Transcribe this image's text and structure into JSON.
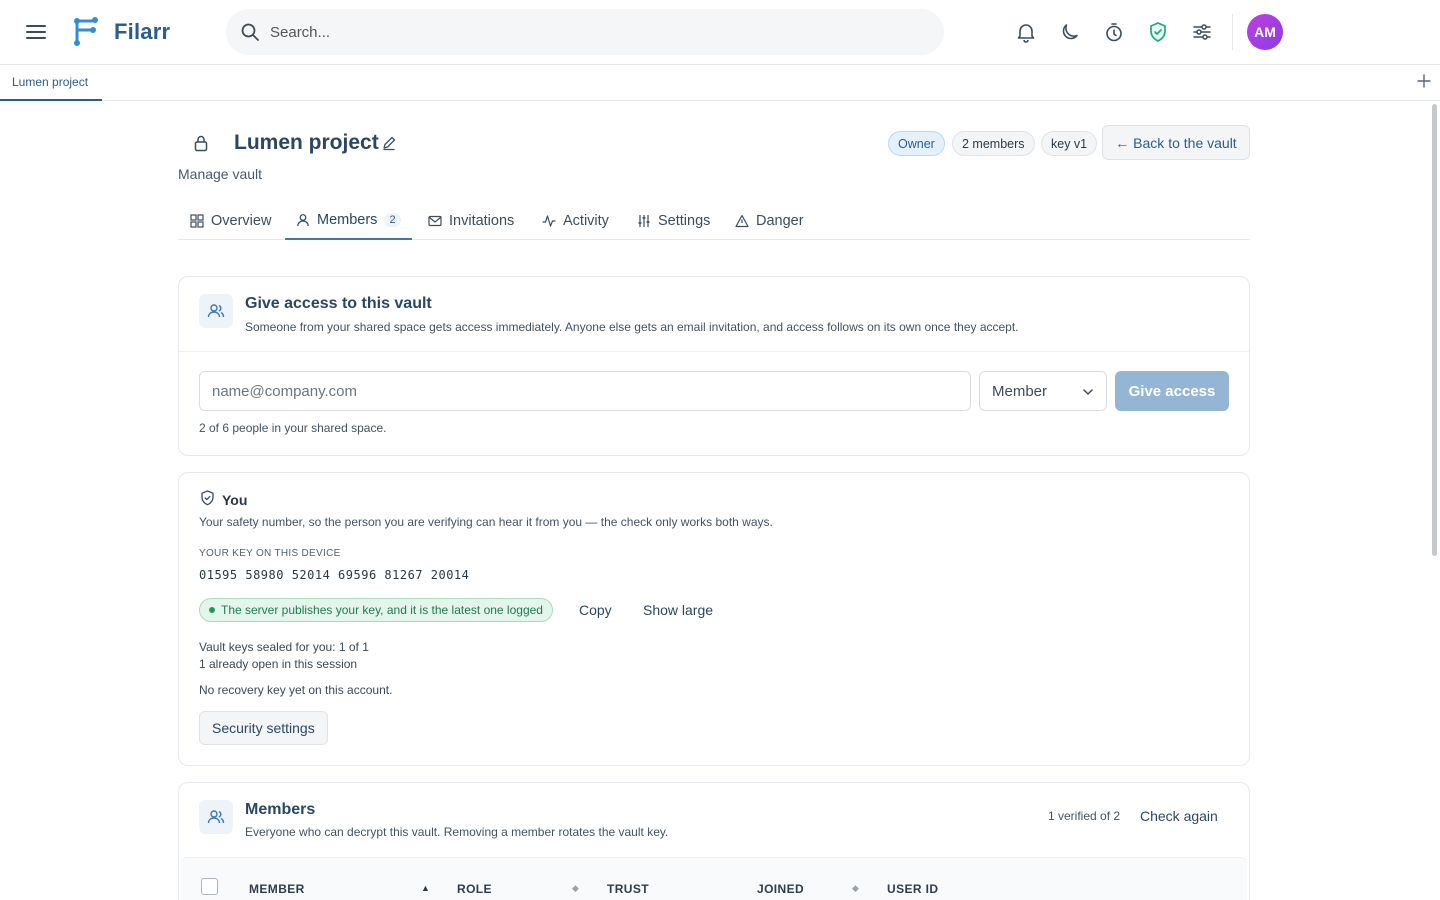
{
  "app": {
    "name": "Filarr"
  },
  "header": {
    "search_placeholder": "Search...",
    "avatar_initials": "AM"
  },
  "tabs": {
    "open": [
      "Lumen project"
    ]
  },
  "vault": {
    "title": "Lumen project",
    "subtitle": "Manage vault",
    "badges": {
      "role": "Owner",
      "members": "2 members",
      "key": "key v1"
    },
    "back_label": "← Back to the vault"
  },
  "section_tabs": [
    {
      "label": "Overview",
      "icon": "grid-icon"
    },
    {
      "label": "Members",
      "icon": "user-icon",
      "count": "2"
    },
    {
      "label": "Invitations",
      "icon": "mail-icon"
    },
    {
      "label": "Activity",
      "icon": "activity-icon"
    },
    {
      "label": "Settings",
      "icon": "sliders-icon"
    },
    {
      "label": "Danger",
      "icon": "warning-icon"
    }
  ],
  "give_access": {
    "title": "Give access to this vault",
    "description": "Someone from your shared space gets access immediately. Anyone else gets an email invitation, and access follows on its own once they accept.",
    "email_placeholder": "name@company.com",
    "role_selected": "Member",
    "button_label": "Give access",
    "hint": "2 of 6 people in your shared space."
  },
  "you": {
    "title": "You",
    "description": "Your safety number, so the person you are verifying can hear it from you — the check only works both ways.",
    "key_label": "YOUR KEY ON THIS DEVICE",
    "key_value": "01595 58980 52014 69596 81267 20014",
    "status": "The server publishes your key, and it is the latest one logged",
    "copy_label": "Copy",
    "show_large_label": "Show large",
    "sealed_line": "Vault keys sealed for you: 1 of 1",
    "open_line": "1 already open in this session",
    "recovery_line": "No recovery key yet on this account.",
    "security_button": "Security settings"
  },
  "members": {
    "title": "Members",
    "description": "Everyone who can decrypt this vault. Removing a member rotates the vault key.",
    "verified": "1 verified of 2",
    "check_again": "Check again",
    "columns": [
      "MEMBER",
      "ROLE",
      "TRUST",
      "JOINED",
      "USER ID"
    ]
  },
  "colors": {
    "accent": "#2c5d8a",
    "avatar": "#a33fe2",
    "success": "#1f7a4c",
    "shield": "#1fa97a"
  }
}
